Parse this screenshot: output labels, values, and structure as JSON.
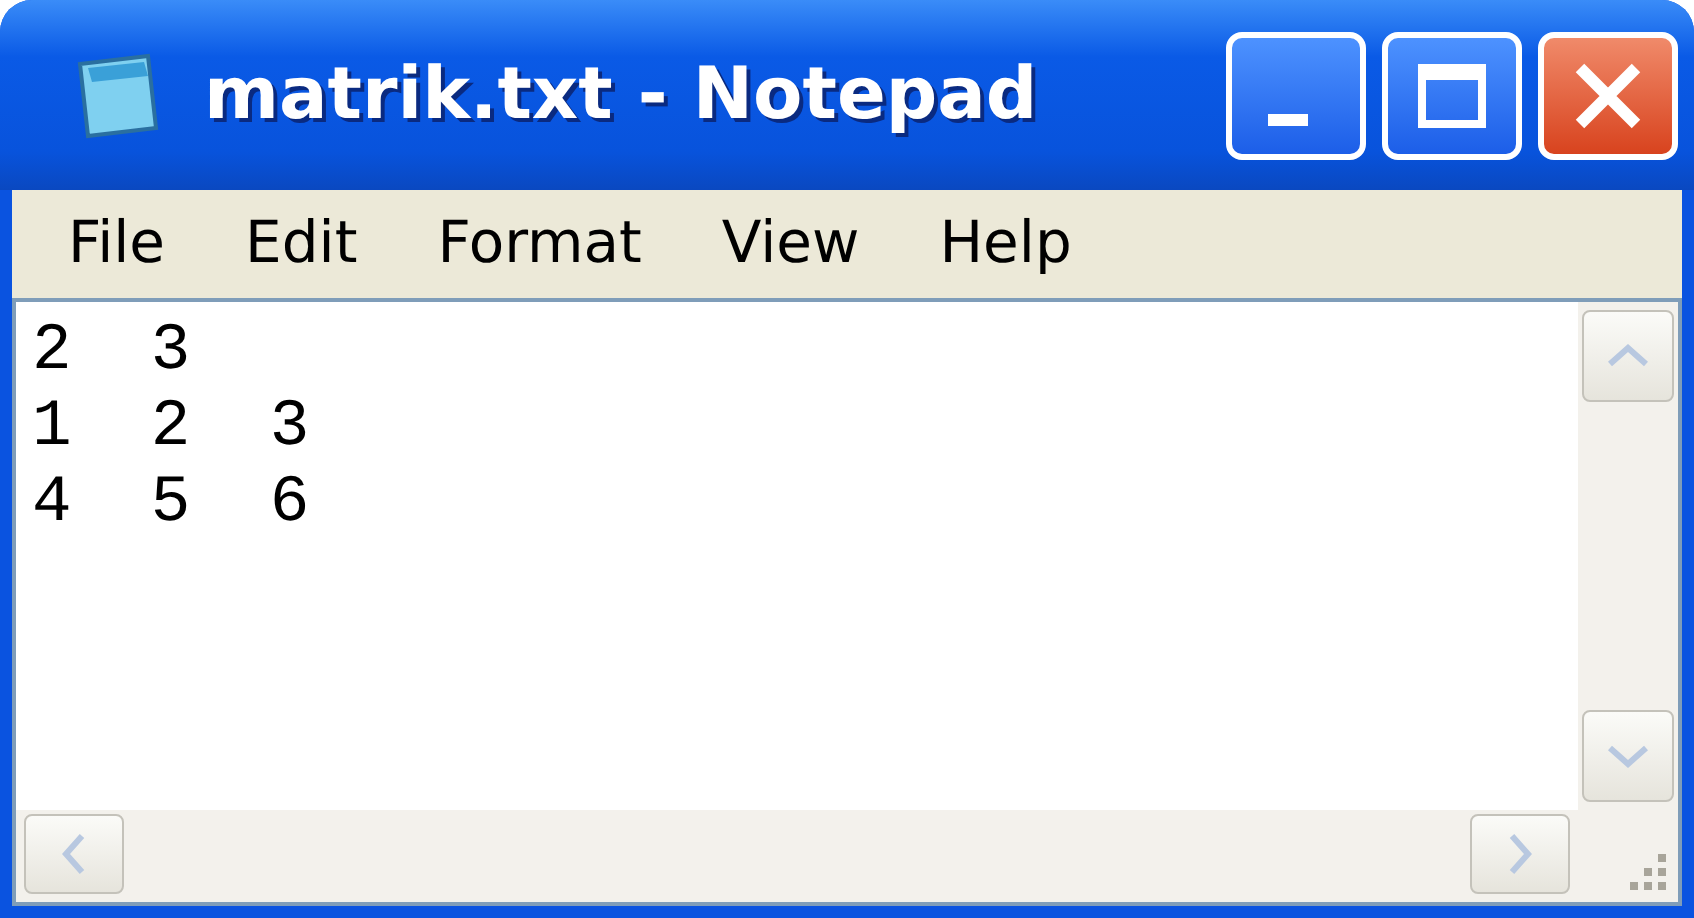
{
  "window": {
    "title": "matrik.txt - Notepad"
  },
  "menu": [
    {
      "label": "File"
    },
    {
      "label": "Edit"
    },
    {
      "label": "Format"
    },
    {
      "label": "View"
    },
    {
      "label": "Help"
    }
  ],
  "document": {
    "lines": [
      "2  3",
      "1  2  3",
      "4  5  6"
    ]
  }
}
